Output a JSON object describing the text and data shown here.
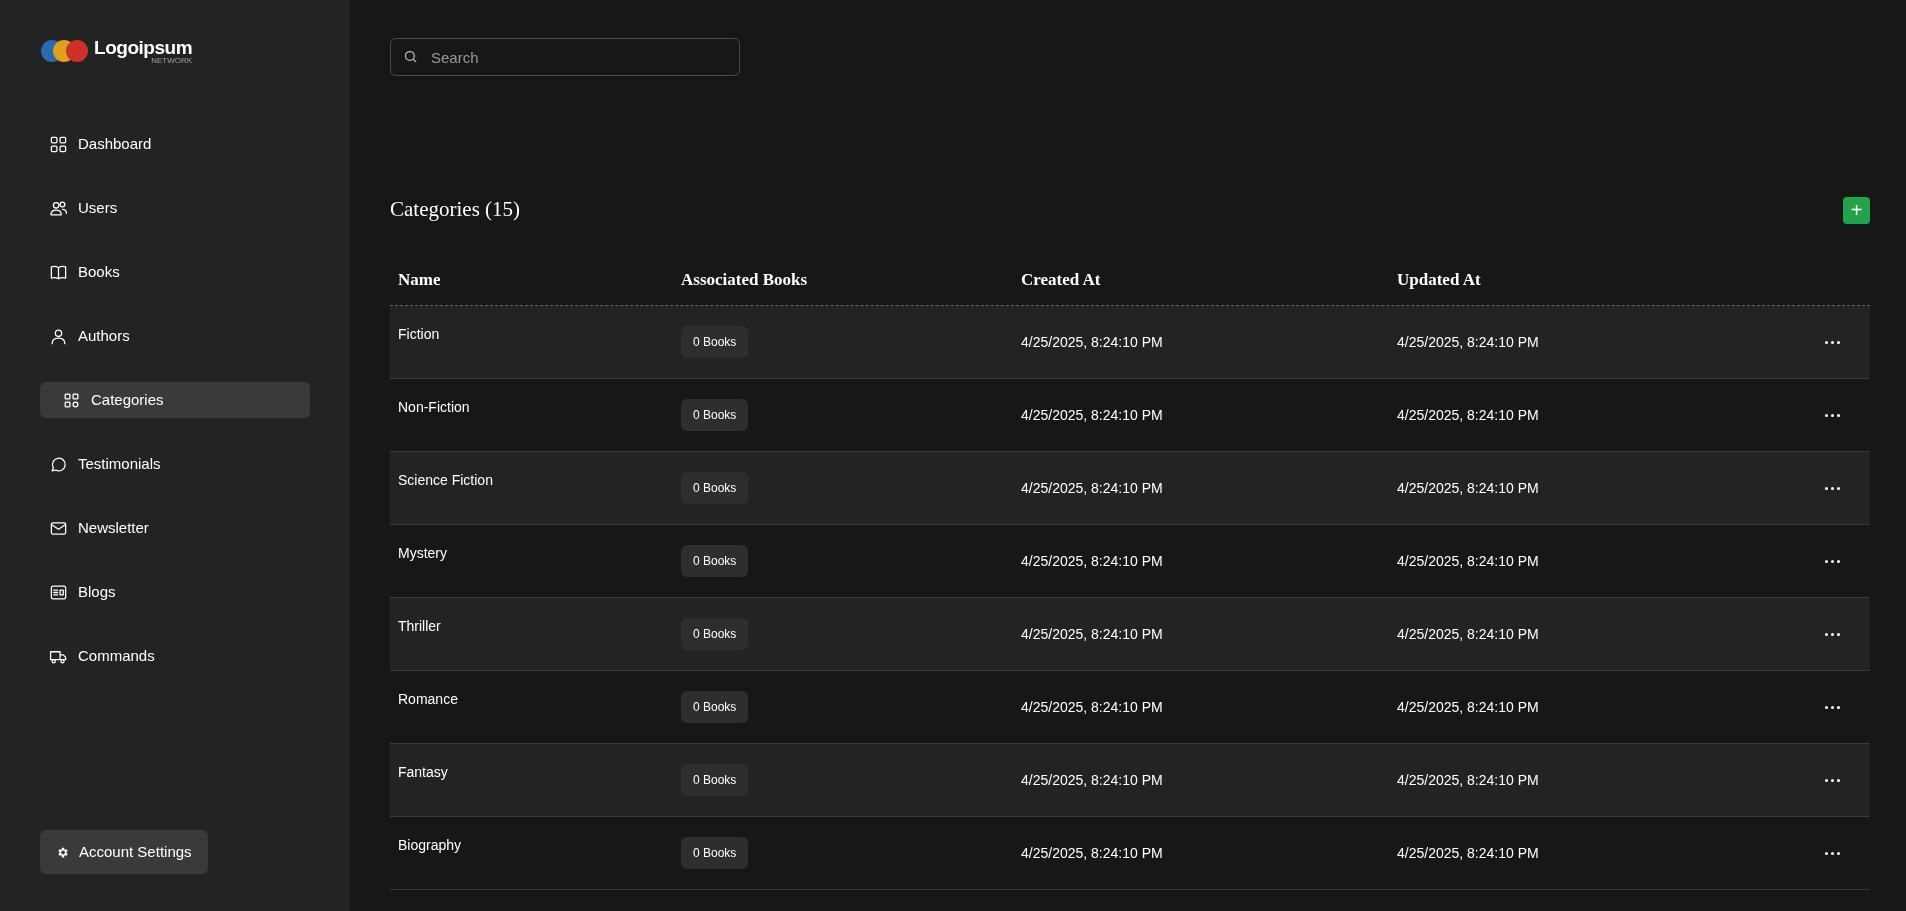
{
  "logo": {
    "name": "Logoipsum",
    "tagline": "NETWORK"
  },
  "sidebar": {
    "items": [
      {
        "label": "Dashboard",
        "selected": false
      },
      {
        "label": "Users",
        "selected": false
      },
      {
        "label": "Books",
        "selected": false
      },
      {
        "label": "Authors",
        "selected": false
      },
      {
        "label": "Categories",
        "selected": true
      },
      {
        "label": "Testimonials",
        "selected": false
      },
      {
        "label": "Newsletter",
        "selected": false
      },
      {
        "label": "Blogs",
        "selected": false
      },
      {
        "label": "Commands",
        "selected": false
      }
    ],
    "account_button": "Account Settings"
  },
  "search": {
    "placeholder": "Search"
  },
  "heading": "Categories (15)",
  "add_button": "+",
  "table": {
    "columns": [
      "Name",
      "Associated Books",
      "Created At",
      "Updated At"
    ],
    "rows": [
      {
        "name": "Fiction",
        "books": "0 Books",
        "created": "4/25/2025, 8:24:10 PM",
        "updated": "4/25/2025, 8:24:10 PM"
      },
      {
        "name": "Non-Fiction",
        "books": "0 Books",
        "created": "4/25/2025, 8:24:10 PM",
        "updated": "4/25/2025, 8:24:10 PM"
      },
      {
        "name": "Science Fiction",
        "books": "0 Books",
        "created": "4/25/2025, 8:24:10 PM",
        "updated": "4/25/2025, 8:24:10 PM"
      },
      {
        "name": "Mystery",
        "books": "0 Books",
        "created": "4/25/2025, 8:24:10 PM",
        "updated": "4/25/2025, 8:24:10 PM"
      },
      {
        "name": "Thriller",
        "books": "0 Books",
        "created": "4/25/2025, 8:24:10 PM",
        "updated": "4/25/2025, 8:24:10 PM"
      },
      {
        "name": "Romance",
        "books": "0 Books",
        "created": "4/25/2025, 8:24:10 PM",
        "updated": "4/25/2025, 8:24:10 PM"
      },
      {
        "name": "Fantasy",
        "books": "0 Books",
        "created": "4/25/2025, 8:24:10 PM",
        "updated": "4/25/2025, 8:24:10 PM"
      },
      {
        "name": "Biography",
        "books": "0 Books",
        "created": "4/25/2025, 8:24:10 PM",
        "updated": "4/25/2025, 8:24:10 PM"
      }
    ]
  }
}
